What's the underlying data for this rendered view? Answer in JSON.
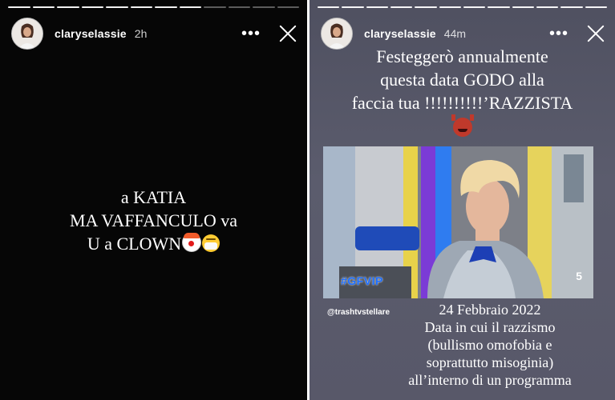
{
  "left_story": {
    "username": "claryselassie",
    "time": "2h",
    "more_label": "•••",
    "lines": [
      "a KATIA",
      "MA VAFFANCULO va",
      "U a CLOWN"
    ],
    "progress_segments": 12,
    "progress_done": 8
  },
  "right_story": {
    "username": "claryselassie",
    "time": "44m",
    "more_label": "•••",
    "title_lines": [
      "Festeggerò annualmente",
      "questa data GODO alla",
      "faccia tua !!!!!!!!!!’RAZZISTA"
    ],
    "video_badge": "#GFVIP",
    "channel_logo": "5",
    "credit": "@trashtvstellare",
    "body_lines": [
      "24 Febbraio 2022",
      "Data in cui il razzismo",
      "(bullismo omofobia e",
      "soprattutto misoginia)",
      "all’interno di un programma"
    ],
    "progress_segments": 12,
    "progress_done": 12
  },
  "icons": {
    "left_emojis": [
      "clown-face-icon",
      "face-with-medical-mask-icon"
    ],
    "right_emoji": "smiling-devil-icon"
  },
  "colors": {
    "left_bg": "#060606",
    "right_bg": "#5a5a6b"
  }
}
